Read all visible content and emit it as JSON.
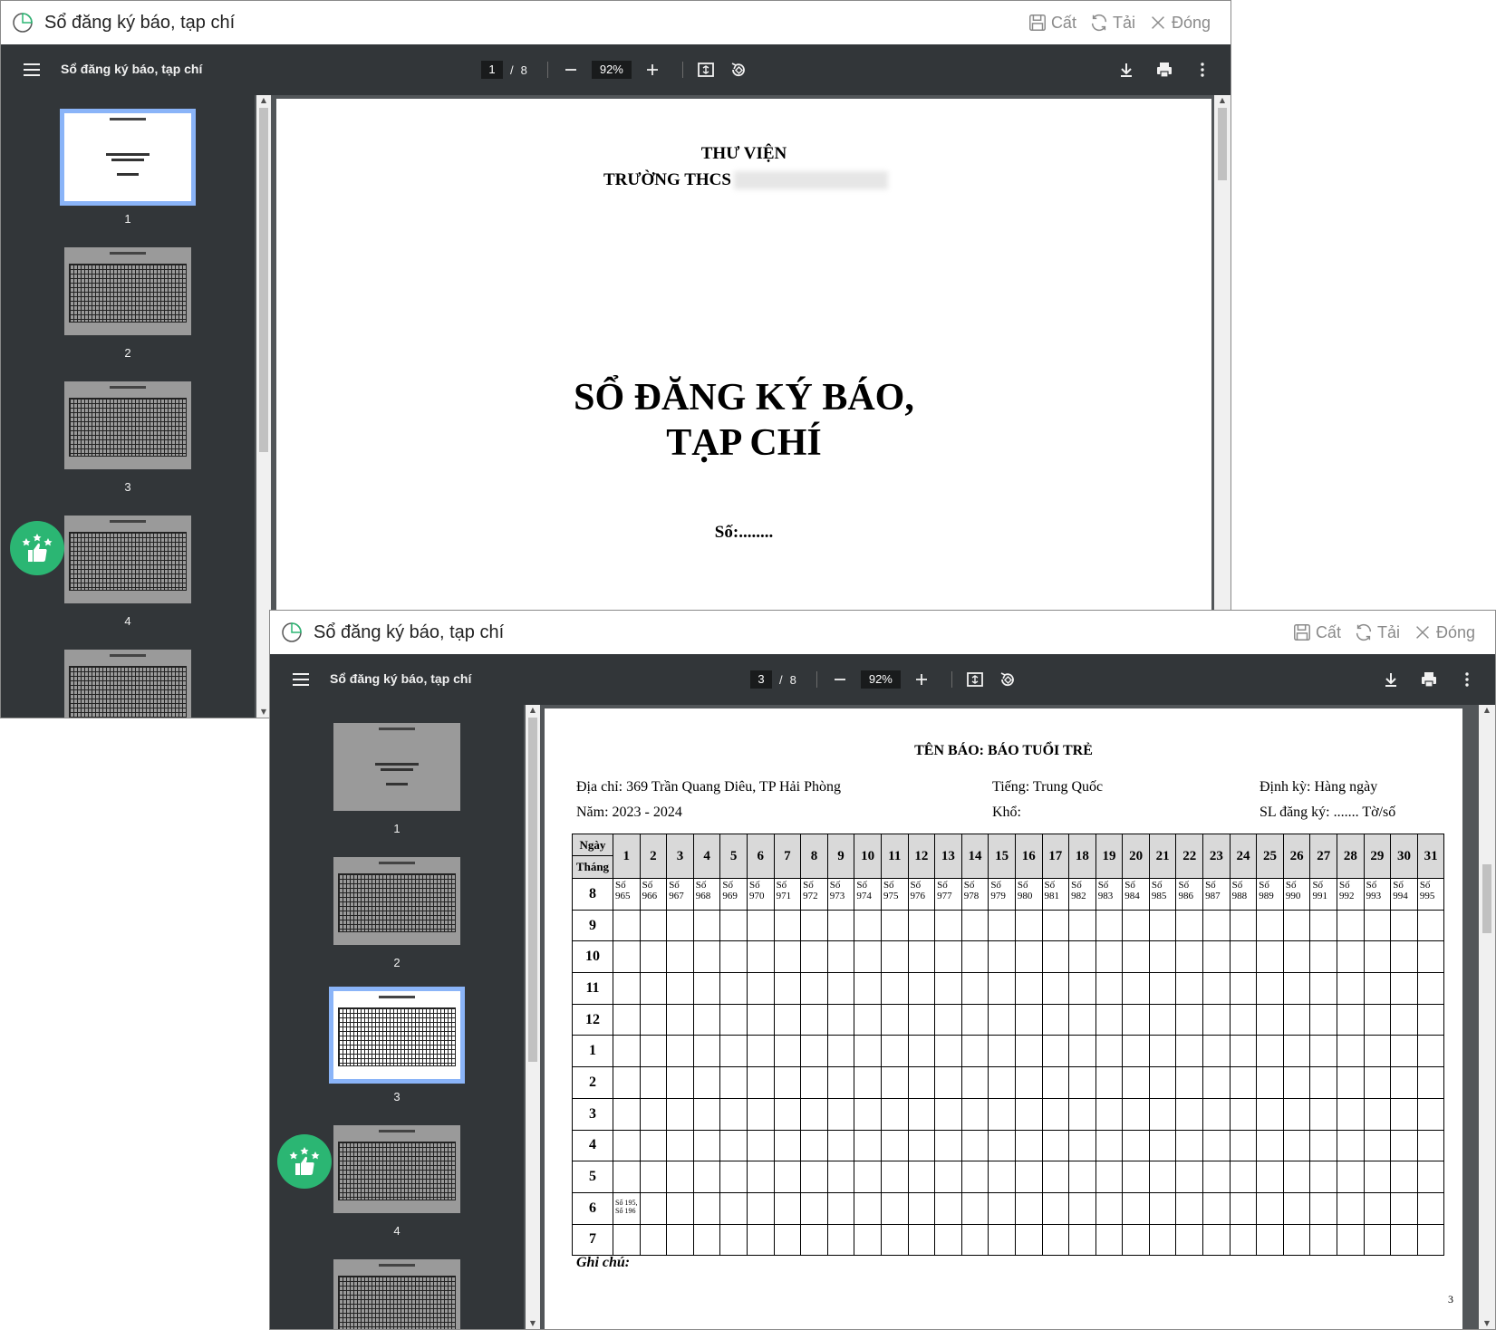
{
  "app_title": "Sổ đăng ký báo, tạp chí",
  "actions": {
    "save": "Cất",
    "reload": "Tải",
    "close": "Đóng"
  },
  "viewer": {
    "doc_title": "Sổ đăng ký báo, tạp chí",
    "total_pages": "8",
    "zoom": "92%",
    "page_sep": "/"
  },
  "window1": {
    "current_page": "1"
  },
  "window2": {
    "current_page": "3"
  },
  "thumbnails": [
    "1",
    "2",
    "3",
    "4"
  ],
  "cover": {
    "library": "THƯ VIỆN",
    "school": "TRƯỜNG THCS",
    "title_line1": "SỔ ĐĂNG KÝ BÁO,",
    "title_line2": "TẠP CHÍ",
    "number": "Số:........"
  },
  "register": {
    "title": "TÊN BÁO: BÁO TUỔI TRẺ",
    "address": "Địa chỉ: 369 Trần Quang Diêu, TP Hải Phòng",
    "language": "Tiếng: Trung Quốc",
    "period": "Định kỳ: Hàng ngày",
    "year": "Năm: 2023 - 2024",
    "size": "Khổ:",
    "quantity": "SL đăng ký: ....... Tờ/số",
    "header_day": "Ngày",
    "header_month": "Tháng",
    "days": [
      "1",
      "2",
      "3",
      "4",
      "5",
      "6",
      "7",
      "8",
      "9",
      "10",
      "11",
      "12",
      "13",
      "14",
      "15",
      "16",
      "17",
      "18",
      "19",
      "20",
      "21",
      "22",
      "23",
      "24",
      "25",
      "26",
      "27",
      "28",
      "29",
      "30",
      "31"
    ],
    "months": [
      "8",
      "9",
      "10",
      "11",
      "12",
      "1",
      "2",
      "3",
      "4",
      "5",
      "6",
      "7"
    ],
    "issue_prefix": "Số",
    "row_aug_issues": [
      "965",
      "966",
      "967",
      "968",
      "969",
      "970",
      "971",
      "972",
      "973",
      "974",
      "975",
      "976",
      "977",
      "978",
      "979",
      "980",
      "981",
      "982",
      "983",
      "984",
      "985",
      "986",
      "987",
      "988",
      "989",
      "990",
      "991",
      "992",
      "993",
      "994",
      "995"
    ],
    "row_jun_note_1": "Số 195,",
    "row_jun_note_2": "Số 196",
    "note": "Ghi chú:",
    "page_number": "3"
  }
}
